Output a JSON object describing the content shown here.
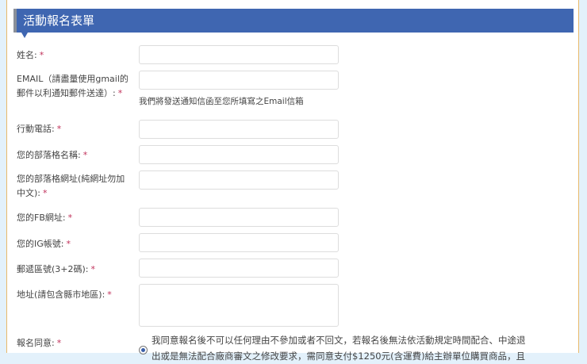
{
  "form": {
    "title": "活動報名表單",
    "required_mark": "*",
    "fields": [
      {
        "label": "姓名:"
      },
      {
        "label": "EMAIL（請盡量使用gmail的郵件以利通知郵件送達）:",
        "help": "我們將發送通知信函至您所填寫之Email信箱"
      },
      {
        "label": "行動電話:"
      },
      {
        "label": "您的部落格名稱:"
      },
      {
        "label": "您的部落格網址(純網址勿加中文):"
      },
      {
        "label": "您的FB網址:"
      },
      {
        "label": "您的IG帳號:"
      },
      {
        "label": "郵遞區號(3+2碼):"
      },
      {
        "label": "地址(請包含縣市地區):"
      },
      {
        "label": "報名同意:"
      }
    ],
    "agree_text_line1": "我同意報名後不可以任何理由不參加或者不回文，若報名後無法依活動規定時間配合、中途退",
    "agree_text_line2": "出或是無法配合廠商審文之修改要求，需同意支付$1250元(含運費)給主辦單位購買商品，且"
  }
}
